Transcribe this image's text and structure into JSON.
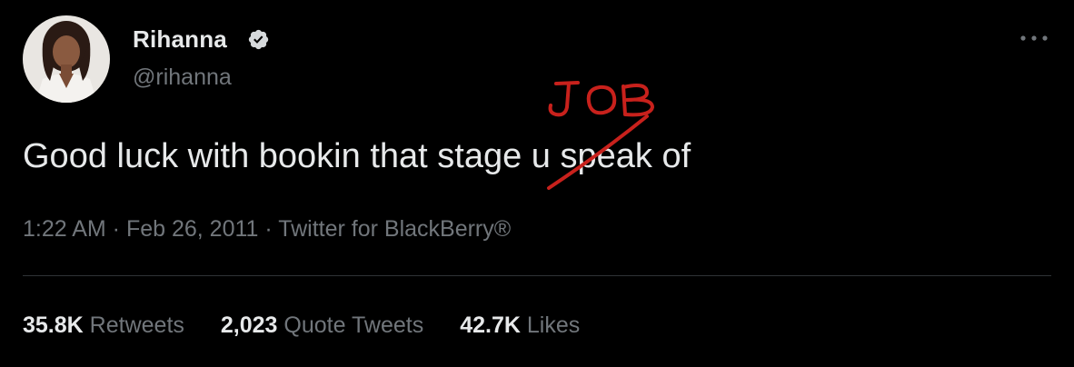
{
  "author": {
    "name": "Rihanna",
    "handle": "@rihanna",
    "verified": true,
    "verified_icon": "verified-badge-icon"
  },
  "tweet": {
    "text_before": "Good luck with bookin that ",
    "struck_word_start": "st",
    "struck_word_mid": "age",
    "text_after": " u speak of",
    "annotation_text": "JOB",
    "annotation_color": "#c8211c"
  },
  "meta": {
    "time": "1:22 AM",
    "separator": " · ",
    "date": "Feb 26, 2011",
    "source": "Twitter for BlackBerry®"
  },
  "stats": [
    {
      "value": "35.8K",
      "label": "Retweets"
    },
    {
      "value": "2,023",
      "label": "Quote Tweets"
    },
    {
      "value": "42.7K",
      "label": "Likes"
    }
  ],
  "menu": {
    "icon": "more-options-icon"
  },
  "colors": {
    "background": "#000000",
    "text": "#e7e9ea",
    "secondary": "#71767b",
    "divider": "#2f3336",
    "verified": "#d6d9db"
  }
}
